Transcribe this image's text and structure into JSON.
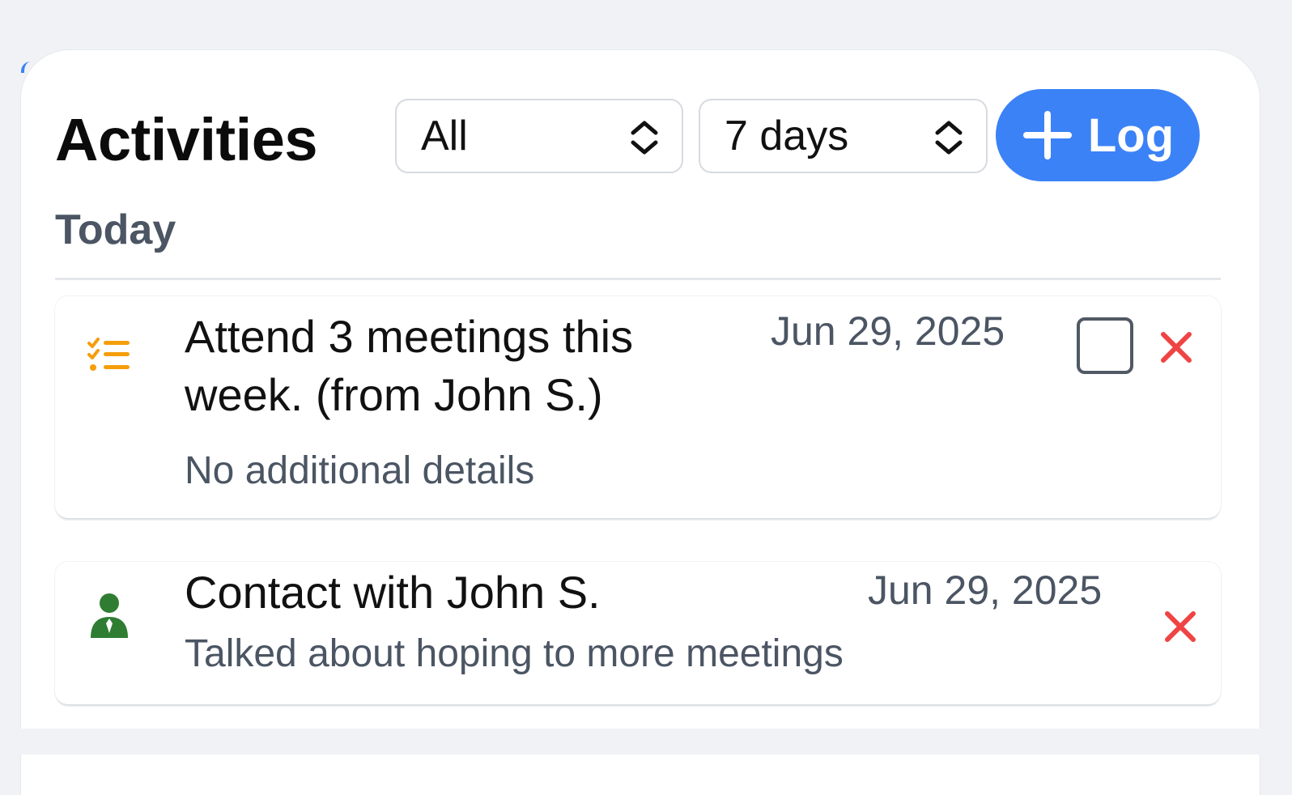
{
  "header": {
    "title": "Activities",
    "type_filter": {
      "selected": "All"
    },
    "range_filter": {
      "selected": "7 days"
    },
    "log_button_label": "Log"
  },
  "sections": [
    {
      "label": "Today",
      "items": [
        {
          "icon": "task-list-icon",
          "icon_color": "#f59e0b",
          "title": "Attend 3 meetings this week. (from John S.)",
          "date": "Jun 29, 2025",
          "details": "No additional details",
          "has_checkbox": true,
          "checked": false
        },
        {
          "icon": "contact-person-icon",
          "icon_color": "#2f7d32",
          "title": "Contact with John S.",
          "date": "Jun 29, 2025",
          "details": "Talked about hoping to more meetings",
          "has_checkbox": false
        }
      ]
    }
  ],
  "colors": {
    "accent": "#3b82f6",
    "delete": "#ef4444",
    "muted_text": "#4b5563"
  }
}
